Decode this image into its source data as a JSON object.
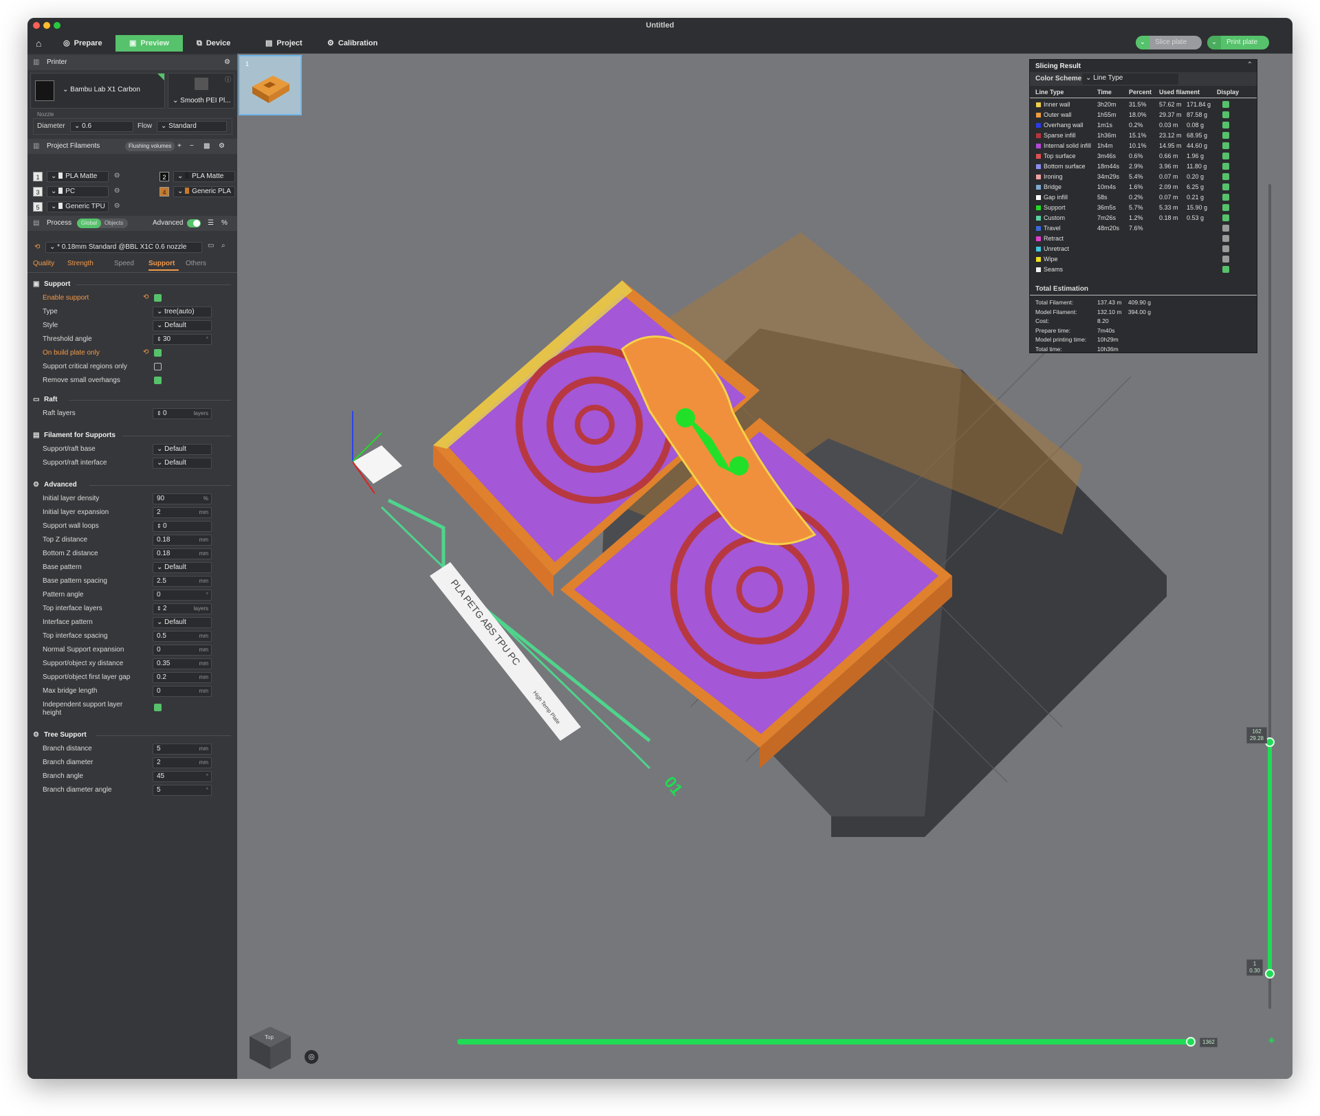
{
  "window": {
    "title": "Untitled"
  },
  "menu": {
    "prepare": "Prepare",
    "preview": "Preview",
    "device": "Device",
    "project": "Project",
    "calibration": "Calibration",
    "slice_plate": "Slice plate",
    "print_plate": "Print plate"
  },
  "printer": {
    "header": "Printer",
    "name": "Bambu Lab X1 Carbon",
    "plate": "Smooth PEI Pl...",
    "nozzle_label": "Nozzle",
    "diameter_label": "Diameter",
    "diameter": "0.6",
    "flow_label": "Flow",
    "flow": "Standard"
  },
  "filaments": {
    "header": "Project Filaments",
    "flushing": "Flushing volumes",
    "items": [
      {
        "num": "1",
        "name": "PLA Matte",
        "color": "#e8e8e8"
      },
      {
        "num": "2",
        "name": "PLA Matte",
        "color": "#222222"
      },
      {
        "num": "3",
        "name": "PC",
        "color": "#e8e8e8"
      },
      {
        "num": "4",
        "name": "Generic PLA",
        "color": "#c77a2b"
      },
      {
        "num": "5",
        "name": "Generic TPU",
        "color": "#e8e8e8"
      }
    ]
  },
  "process": {
    "header": "Process",
    "global": "Global",
    "objects": "Objects",
    "advanced": "Advanced",
    "preset": "* 0.18mm Standard @BBL X1C 0.6 nozzle",
    "tabs": [
      "Quality",
      "Strength",
      "Speed",
      "Support",
      "Others"
    ]
  },
  "support": {
    "header": "Support",
    "enable_support": "Enable support",
    "type_label": "Type",
    "type": "tree(auto)",
    "style_label": "Style",
    "style": "Default",
    "threshold_label": "Threshold angle",
    "threshold": "30",
    "threshold_unit": "°",
    "build_plate_only": "On build plate only",
    "critical_only": "Support critical regions only",
    "remove_small": "Remove small overhangs"
  },
  "raft": {
    "header": "Raft",
    "layers_label": "Raft layers",
    "layers": "0",
    "layers_unit": "layers"
  },
  "filament_supports": {
    "header": "Filament for Supports",
    "base_label": "Support/raft base",
    "base": "Default",
    "interface_label": "Support/raft interface",
    "interface": "Default"
  },
  "advanced": {
    "header": "Advanced",
    "rows": [
      {
        "label": "Initial layer density",
        "value": "90",
        "unit": "%"
      },
      {
        "label": "Initial layer expansion",
        "value": "2",
        "unit": "mm"
      },
      {
        "label": "Support wall loops",
        "value": "0",
        "unit": ""
      },
      {
        "label": "Top Z distance",
        "value": "0.18",
        "unit": "mm"
      },
      {
        "label": "Bottom Z distance",
        "value": "0.18",
        "unit": "mm"
      },
      {
        "label": "Base pattern",
        "value": "Default",
        "unit": ""
      },
      {
        "label": "Base pattern spacing",
        "value": "2.5",
        "unit": "mm"
      },
      {
        "label": "Pattern angle",
        "value": "0",
        "unit": "°"
      },
      {
        "label": "Top interface layers",
        "value": "2",
        "unit": "layers"
      },
      {
        "label": "Interface pattern",
        "value": "Default",
        "unit": ""
      },
      {
        "label": "Top interface spacing",
        "value": "0.5",
        "unit": "mm"
      },
      {
        "label": "Normal Support expansion",
        "value": "0",
        "unit": "mm"
      },
      {
        "label": "Support/object xy distance",
        "value": "0.35",
        "unit": "mm"
      },
      {
        "label": "Support/object first layer gap",
        "value": "0.2",
        "unit": "mm"
      },
      {
        "label": "Max bridge length",
        "value": "0",
        "unit": "mm"
      }
    ],
    "independent_label_1": "Independent support layer",
    "independent_label_2": "height"
  },
  "tree_support": {
    "header": "Tree Support",
    "rows": [
      {
        "label": "Branch distance",
        "value": "5",
        "unit": "mm"
      },
      {
        "label": "Branch diameter",
        "value": "2",
        "unit": "mm"
      },
      {
        "label": "Branch angle",
        "value": "45",
        "unit": "°"
      },
      {
        "label": "Branch diameter angle",
        "value": "5",
        "unit": "°"
      }
    ]
  },
  "slicing": {
    "header": "Slicing Result",
    "color_scheme_label": "Color Scheme",
    "color_scheme": "Line Type",
    "columns": [
      "Line Type",
      "Time",
      "Percent",
      "Used filament",
      "Display"
    ],
    "rows": [
      {
        "name": "Inner wall",
        "color": "#f0d04a",
        "time": "3h20m",
        "percent": "31.5%",
        "len": "57.62 m",
        "weight": "171.84 g",
        "display": true
      },
      {
        "name": "Outer wall",
        "color": "#f09a3e",
        "time": "1h55m",
        "percent": "18.0%",
        "len": "29.37 m",
        "weight": "87.58 g",
        "display": true
      },
      {
        "name": "Overhang wall",
        "color": "#2b3de6",
        "time": "1m1s",
        "percent": "0.2%",
        "len": "0.03 m",
        "weight": "0.08 g",
        "display": true
      },
      {
        "name": "Sparse infill",
        "color": "#b8343c",
        "time": "1h36m",
        "percent": "15.1%",
        "len": "23.12 m",
        "weight": "68.95 g",
        "display": true
      },
      {
        "name": "Internal solid infill",
        "color": "#b04ad6",
        "time": "1h4m",
        "percent": "10.1%",
        "len": "14.95 m",
        "weight": "44.60 g",
        "display": true
      },
      {
        "name": "Top surface",
        "color": "#e05050",
        "time": "3m46s",
        "percent": "0.6%",
        "len": "0.66 m",
        "weight": "1.96 g",
        "display": true
      },
      {
        "name": "Bottom surface",
        "color": "#8c8cf0",
        "time": "18m44s",
        "percent": "2.9%",
        "len": "3.96 m",
        "weight": "11.80 g",
        "display": true
      },
      {
        "name": "Ironing",
        "color": "#f0a0a0",
        "time": "34m29s",
        "percent": "5.4%",
        "len": "0.07 m",
        "weight": "0.20 g",
        "display": true
      },
      {
        "name": "Bridge",
        "color": "#7fa8d0",
        "time": "10m4s",
        "percent": "1.6%",
        "len": "2.09 m",
        "weight": "6.25 g",
        "display": true
      },
      {
        "name": "Gap infill",
        "color": "#ffffff",
        "time": "58s",
        "percent": "0.2%",
        "len": "0.07 m",
        "weight": "0.21 g",
        "display": true
      },
      {
        "name": "Support",
        "color": "#22dd22",
        "time": "36m5s",
        "percent": "5.7%",
        "len": "5.33 m",
        "weight": "15.90 g",
        "display": true
      },
      {
        "name": "Custom",
        "color": "#5ad0a0",
        "time": "7m26s",
        "percent": "1.2%",
        "len": "0.18 m",
        "weight": "0.53 g",
        "display": true
      },
      {
        "name": "Travel",
        "color": "#3a6ad8",
        "time": "48m20s",
        "percent": "7.6%",
        "len": "",
        "weight": "",
        "display": false
      },
      {
        "name": "Retract",
        "color": "#e040d0",
        "time": "",
        "percent": "",
        "len": "",
        "weight": "",
        "display": false
      },
      {
        "name": "Unretract",
        "color": "#40c8e0",
        "time": "",
        "percent": "",
        "len": "",
        "weight": "",
        "display": false
      },
      {
        "name": "Wipe",
        "color": "#f0e020",
        "time": "",
        "percent": "",
        "len": "",
        "weight": "",
        "display": false
      },
      {
        "name": "Seams",
        "color": "#f0f0f0",
        "time": "",
        "percent": "",
        "len": "",
        "weight": "",
        "display": true
      }
    ],
    "total_header": "Total Estimation",
    "totals": [
      {
        "label": "Total Filament:",
        "value": "137.43 m    409.90 g"
      },
      {
        "label": "Model Filament:",
        "value": "132.10 m    394.00 g"
      },
      {
        "label": "Cost:",
        "value": "8.20"
      },
      {
        "label": "Prepare time:",
        "value": "7m40s"
      },
      {
        "label": "Model printing time:",
        "value": "10h29m"
      },
      {
        "label": "Total time:",
        "value": "10h36m"
      }
    ]
  },
  "viewport": {
    "thumb_number": "1",
    "plate_number": "01",
    "plate_label_left": "PLA PETG ABS TPU PC",
    "plate_label_right": "High Temp Plate",
    "layer_top": "162",
    "layer_top_height": "29.28",
    "layer_bottom": "1",
    "layer_bottom_height": "0.30",
    "move_count": "1362",
    "cube_label": "Top"
  }
}
